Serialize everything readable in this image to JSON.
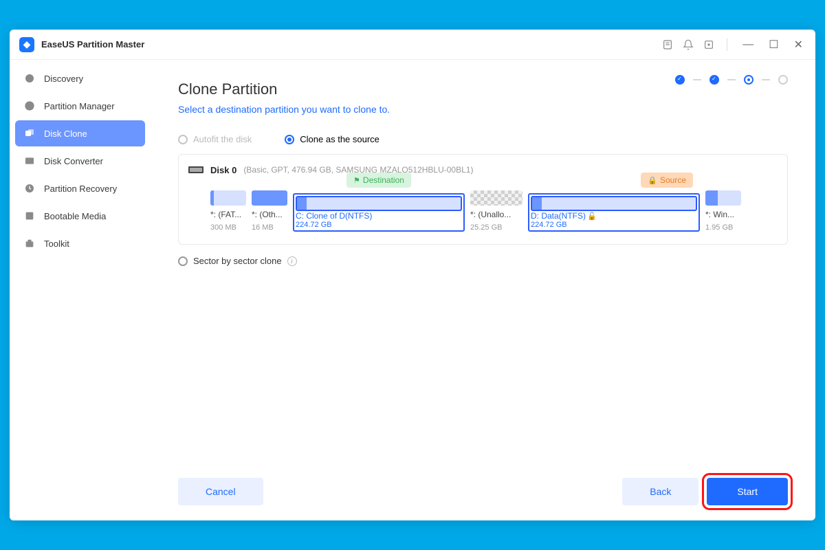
{
  "app_title": "EaseUS Partition Master",
  "sidebar": {
    "items": [
      {
        "label": "Discovery"
      },
      {
        "label": "Partition Manager"
      },
      {
        "label": "Disk Clone"
      },
      {
        "label": "Disk Converter"
      },
      {
        "label": "Partition Recovery"
      },
      {
        "label": "Bootable Media"
      },
      {
        "label": "Toolkit"
      }
    ]
  },
  "page": {
    "title": "Clone Partition",
    "subtitle": "Select a destination partition you want to clone to.",
    "radio_autofit": "Autofit the disk",
    "radio_source": "Clone as the source",
    "sector_label": "Sector by sector clone"
  },
  "disk": {
    "name": "Disk 0",
    "info": "(Basic, GPT, 476.94 GB, SAMSUNG MZALQ512HBLU-00BL1)"
  },
  "badges": {
    "destination": "Destination",
    "source": "Source"
  },
  "partitions": [
    {
      "label": "*: (FAT...",
      "size": "300 MB"
    },
    {
      "label": "*: (Oth...",
      "size": "16 MB"
    },
    {
      "label": "C: Clone of D(NTFS)",
      "size": "224.72 GB"
    },
    {
      "label": "*: (Unallo...",
      "size": "25.25 GB"
    },
    {
      "label": "D: Data(NTFS)",
      "size": "224.72 GB"
    },
    {
      "label": "*: Win...",
      "size": "1.95 GB"
    }
  ],
  "buttons": {
    "cancel": "Cancel",
    "back": "Back",
    "start": "Start"
  }
}
